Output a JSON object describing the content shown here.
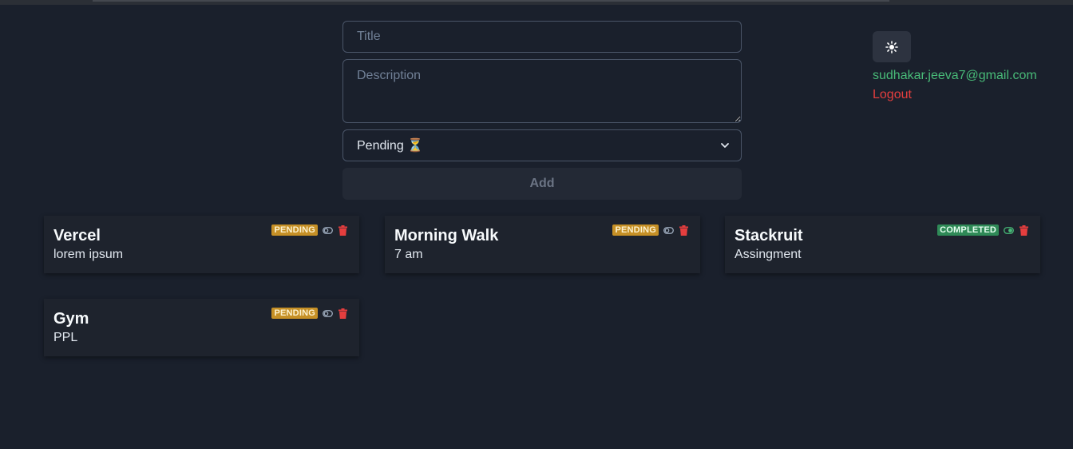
{
  "form": {
    "title_placeholder": "Title",
    "description_placeholder": "Description",
    "status_selected": "Pending ⏳",
    "add_label": "Add"
  },
  "user": {
    "email": "sudhakar.jeeva7@gmail.com",
    "logout_label": "Logout"
  },
  "colors": {
    "background": "#1a202c",
    "pending": "#c69026",
    "completed": "#2f8a57",
    "delete": "#e53e3e",
    "email": "#48bb78"
  },
  "todos": [
    {
      "title": "Vercel",
      "description": "lorem ipsum",
      "status": "PENDING",
      "toggle_icon": "toggle-off-icon"
    },
    {
      "title": "Morning Walk",
      "description": "7 am",
      "status": "PENDING",
      "toggle_icon": "toggle-off-icon"
    },
    {
      "title": "Stackruit",
      "description": "Assingment",
      "status": "COMPLETED",
      "toggle_icon": "toggle-on-icon"
    },
    {
      "title": "Gym",
      "description": "PPL",
      "status": "PENDING",
      "toggle_icon": "toggle-off-icon"
    }
  ]
}
